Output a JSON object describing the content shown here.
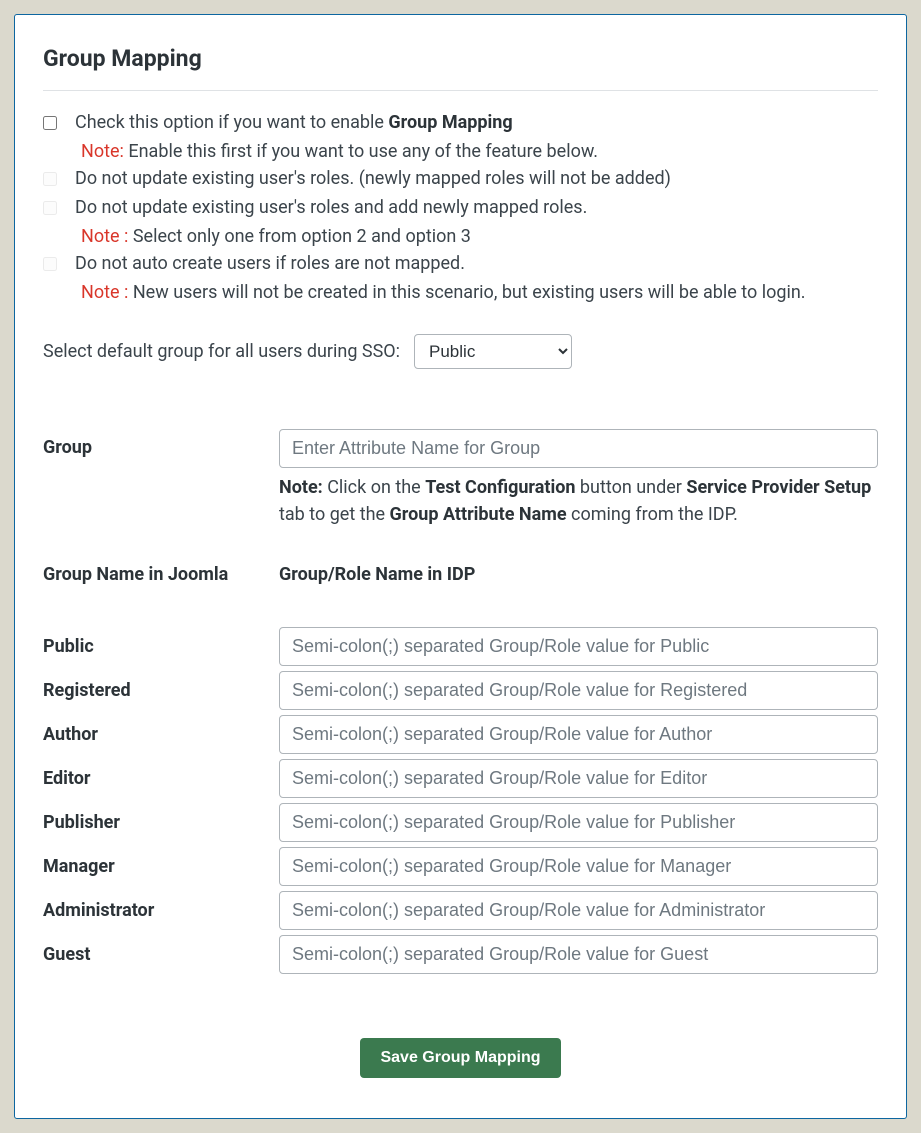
{
  "title": "Group Mapping",
  "options": [
    {
      "label_pre": "Check this option if you want to enable ",
      "label_bold": "Group Mapping",
      "label_post": "",
      "disabled": false,
      "note_label": "Note:",
      "note_text": " Enable this first if you want to use any of the feature below."
    },
    {
      "label_pre": "Do not update existing user's roles. (newly mapped roles will not be added)",
      "label_bold": "",
      "label_post": "",
      "disabled": true,
      "note_label": "",
      "note_text": ""
    },
    {
      "label_pre": "Do not update existing user's roles and add newly mapped roles.",
      "label_bold": "",
      "label_post": "",
      "disabled": true,
      "note_label": "Note :",
      "note_text": " Select only one from option 2 and option 3"
    },
    {
      "label_pre": "Do not auto create users if roles are not mapped.",
      "label_bold": "",
      "label_post": "",
      "disabled": true,
      "note_label": "Note :",
      "note_text": " New users will not be created in this scenario, but existing users will be able to login."
    }
  ],
  "default_group": {
    "label": "Select default group for all users during SSO:",
    "selected": "Public"
  },
  "group_attr": {
    "label": "Group",
    "placeholder": "Enter Attribute Name for Group",
    "help_note_bold": "Note:",
    "help_text_1": " Click on the ",
    "help_bold_1": "Test Configuration",
    "help_text_2": " button under ",
    "help_bold_2": "Service Provider Setup",
    "help_text_3": " tab to get the ",
    "help_bold_3": "Group Attribute Name",
    "help_text_4": " coming from the IDP."
  },
  "headers": {
    "joomla": "Group Name in Joomla",
    "idp": "Group/Role Name in IDP"
  },
  "groups": [
    {
      "name": "Public",
      "placeholder": "Semi-colon(;) separated Group/Role value for Public"
    },
    {
      "name": "Registered",
      "placeholder": "Semi-colon(;) separated Group/Role value for Registered"
    },
    {
      "name": "Author",
      "placeholder": "Semi-colon(;) separated Group/Role value for Author"
    },
    {
      "name": "Editor",
      "placeholder": "Semi-colon(;) separated Group/Role value for Editor"
    },
    {
      "name": "Publisher",
      "placeholder": "Semi-colon(;) separated Group/Role value for Publisher"
    },
    {
      "name": "Manager",
      "placeholder": "Semi-colon(;) separated Group/Role value for Manager"
    },
    {
      "name": "Administrator",
      "placeholder": "Semi-colon(;) separated Group/Role value for Administrator"
    },
    {
      "name": "Guest",
      "placeholder": "Semi-colon(;) separated Group/Role value for Guest"
    }
  ],
  "save_label": "Save Group Mapping"
}
